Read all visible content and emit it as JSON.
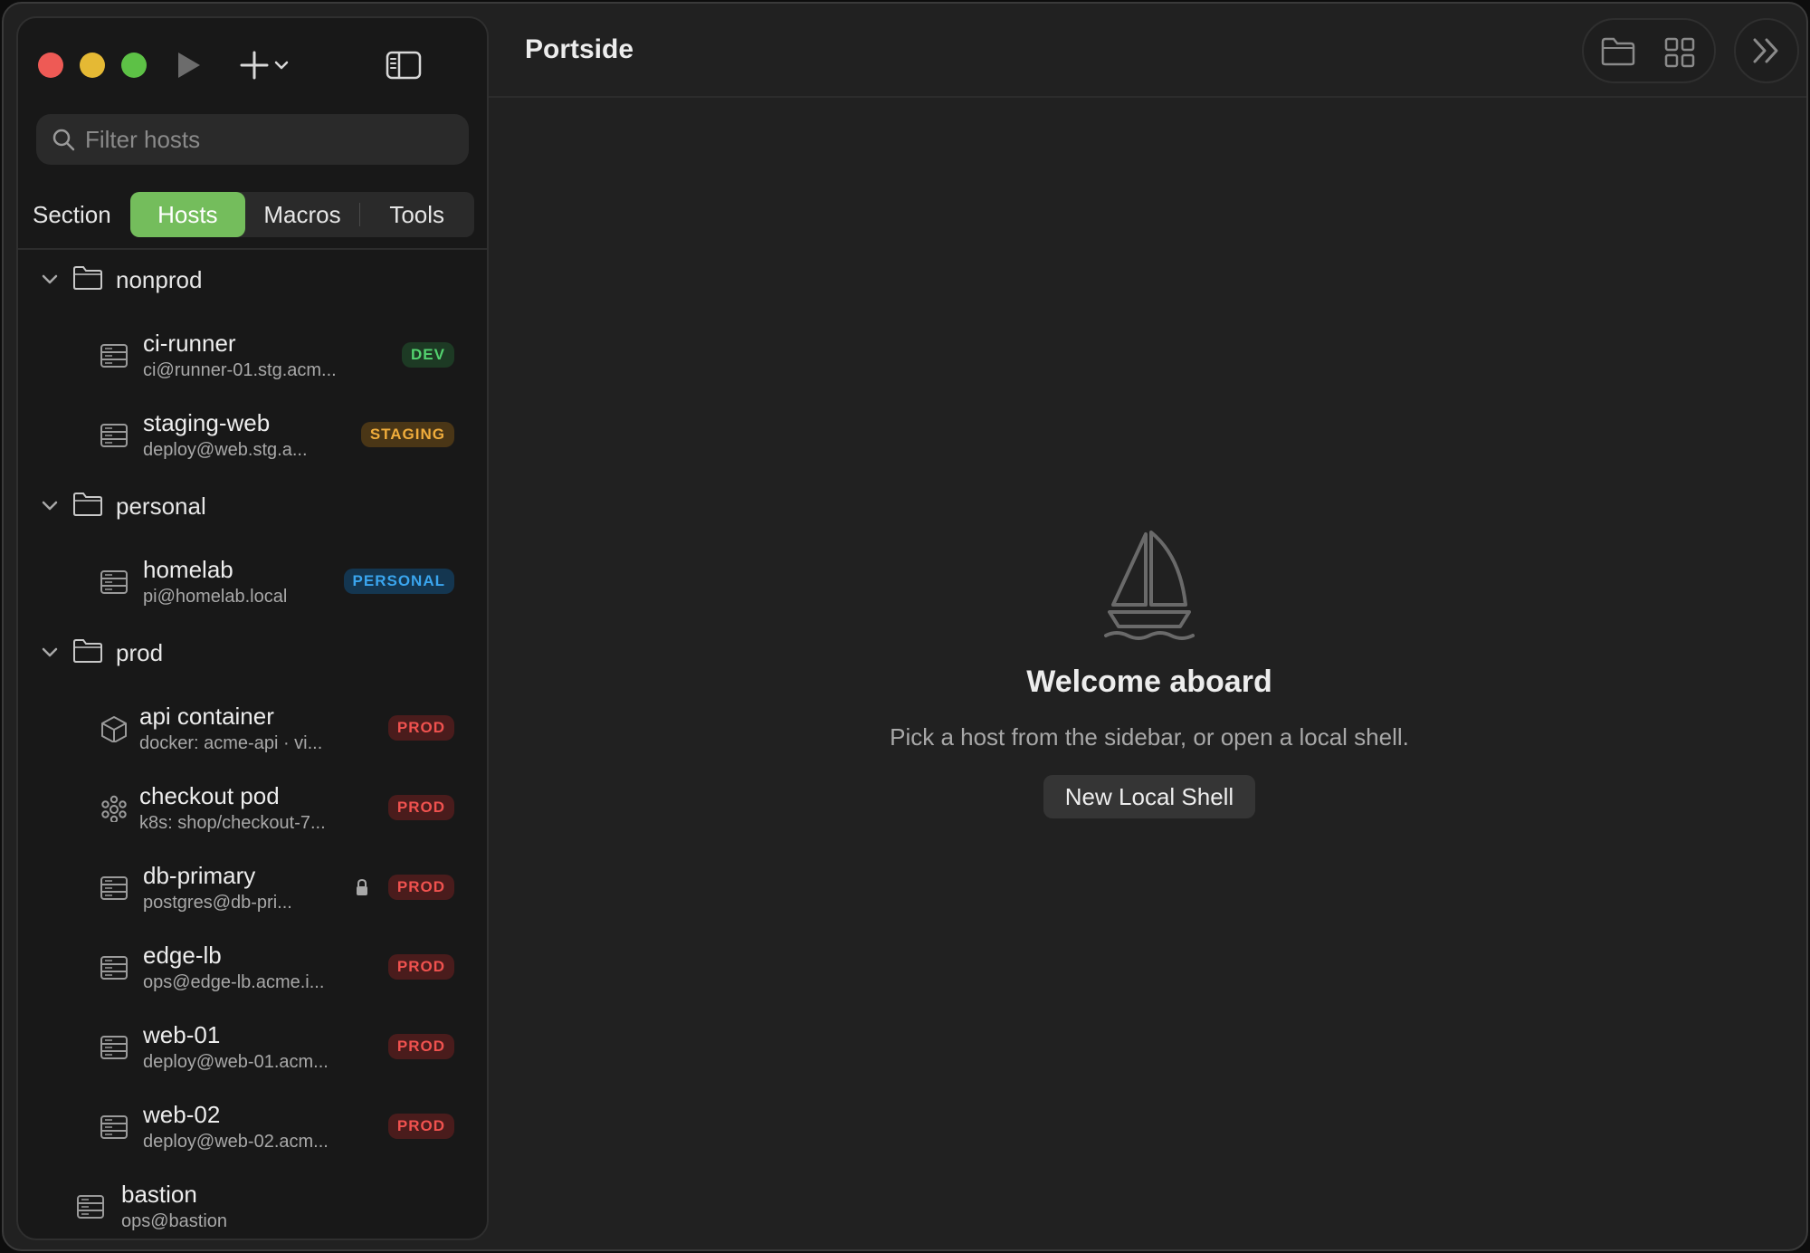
{
  "window": {
    "title": "Portside"
  },
  "search": {
    "placeholder": "Filter hosts"
  },
  "section": {
    "label": "Section",
    "tabs": [
      {
        "label": "Hosts",
        "active": true
      },
      {
        "label": "Macros",
        "active": false
      },
      {
        "label": "Tools",
        "active": false
      }
    ]
  },
  "groups": [
    {
      "name": "nonprod",
      "hosts": [
        {
          "name": "ci-runner",
          "sub": "ci@runner-01.stg.acm...",
          "badge": "DEV",
          "icon": "server-icon"
        },
        {
          "name": "staging-web",
          "sub": "deploy@web.stg.a...",
          "badge": "STAGING",
          "icon": "server-icon"
        }
      ]
    },
    {
      "name": "personal",
      "hosts": [
        {
          "name": "homelab",
          "sub": "pi@homelab.local",
          "badge": "PERSONAL",
          "icon": "server-icon"
        }
      ]
    },
    {
      "name": "prod",
      "hosts": [
        {
          "name": "api container",
          "sub": "docker: acme-api · vi...",
          "badge": "PROD",
          "icon": "container-icon"
        },
        {
          "name": "checkout pod",
          "sub": "k8s: shop/checkout-7...",
          "badge": "PROD",
          "icon": "kubernetes-icon"
        },
        {
          "name": "db-primary",
          "sub": "postgres@db-pri...",
          "badge": "PROD",
          "icon": "server-icon",
          "locked": true
        },
        {
          "name": "edge-lb",
          "sub": "ops@edge-lb.acme.i...",
          "badge": "PROD",
          "icon": "server-icon"
        },
        {
          "name": "web-01",
          "sub": "deploy@web-01.acm...",
          "badge": "PROD",
          "icon": "server-icon"
        },
        {
          "name": "web-02",
          "sub": "deploy@web-02.acm...",
          "badge": "PROD",
          "icon": "server-icon"
        }
      ]
    }
  ],
  "ungrouped": [
    {
      "name": "bastion",
      "sub": "ops@bastion",
      "icon": "server-icon"
    }
  ],
  "empty_state": {
    "title": "Welcome aboard",
    "hint": "Pick a host from the sidebar, or open a local shell.",
    "button": "New Local Shell",
    "icon": "sailboat-icon"
  },
  "colors": {
    "accent": "#74bd5c",
    "dev": "#53d26f",
    "staging": "#f0ad3c",
    "personal": "#3aa5ee",
    "prod": "#f0524f"
  }
}
